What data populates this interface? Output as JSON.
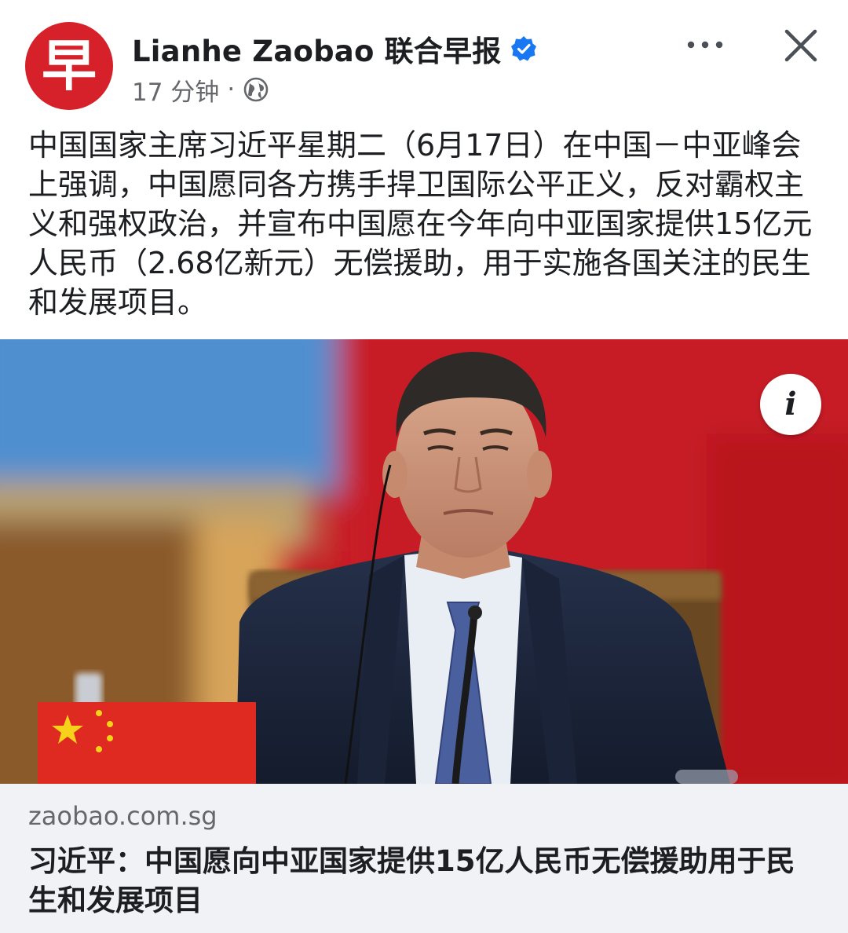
{
  "post": {
    "avatar_glyph": "早",
    "page_name": "Lianhe Zaobao 联合早报",
    "verified": true,
    "time": "17 分钟",
    "separator": "·",
    "audience_icon": "globe-icon",
    "more_icon": "more-horizontal-icon",
    "close_icon": "close-icon",
    "text": "中国国家主席习近平星期二（6月17日）在中国－中亚峰会上强调，中国愿同各方携手捍卫国际公平正义，反对霸权主义和强权政治，并宣布中国愿在今年向中亚国家提供15亿元人民币（2.68亿新元）无偿援助，用于实施各国关注的民生和发展项目。"
  },
  "link_preview": {
    "info_icon": "info-icon",
    "domain": "zaobao.com.sg",
    "title": "习近平：中国愿向中亚国家提供15亿人民币无偿援助用于民生和发展项目"
  },
  "colors": {
    "brand_red": "#d6202a",
    "verified_blue": "#1877f2",
    "meta_gray": "#65676b",
    "card_bg": "#f0f2f5"
  }
}
